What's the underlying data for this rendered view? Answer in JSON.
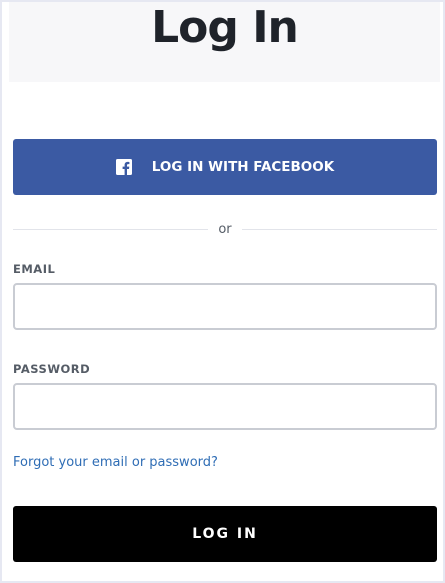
{
  "page": {
    "title": "Log In"
  },
  "facebook": {
    "label": "LOG IN WITH FACEBOOK",
    "icon": "facebook-icon",
    "color": "#3b5aa3"
  },
  "divider": {
    "text": "or"
  },
  "email": {
    "label": "EMAIL",
    "value": "",
    "placeholder": ""
  },
  "password": {
    "label": "PASSWORD",
    "value": "",
    "placeholder": ""
  },
  "forgot": {
    "text": "Forgot your email or password?",
    "color": "#2f6db5"
  },
  "submit": {
    "label": "LOG IN",
    "color": "#000000"
  }
}
